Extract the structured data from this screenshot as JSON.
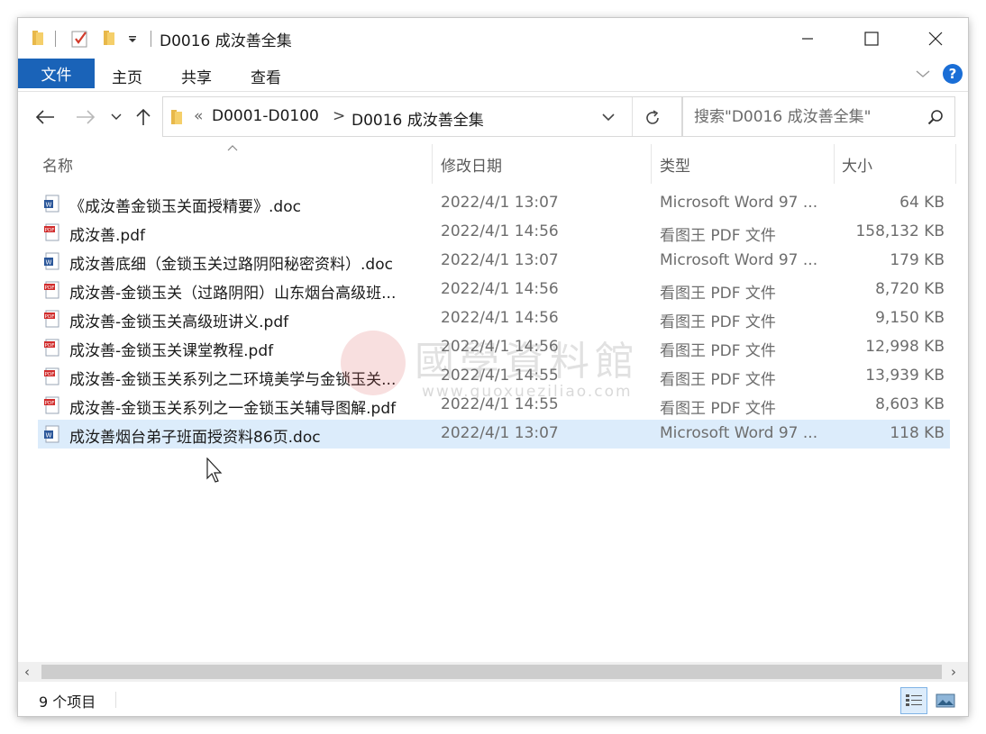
{
  "window": {
    "title": "D0016 成汝善全集",
    "minimize_icon": "minimize-icon",
    "maximize_icon": "maximize-icon",
    "close_icon": "close-icon"
  },
  "ribbon": {
    "tabs": [
      {
        "label": "文件",
        "active": true
      },
      {
        "label": "主页"
      },
      {
        "label": "共享"
      },
      {
        "label": "查看"
      }
    ]
  },
  "navigation": {
    "breadcrumb": [
      "«",
      "D0001-D0100",
      ">",
      "D0016 成汝善全集"
    ]
  },
  "search": {
    "placeholder": "搜索\"D0016 成汝善全集\""
  },
  "columns": {
    "name": "名称",
    "date": "修改日期",
    "type": "类型",
    "size": "大小"
  },
  "files": [
    {
      "name": "《成汝善金锁玉关面授精要》.doc",
      "date": "2022/4/1 13:07",
      "type": "Microsoft Word 97 ...",
      "size": "64 KB",
      "icon": "word-doc-icon"
    },
    {
      "name": "成汝善.pdf",
      "date": "2022/4/1 14:56",
      "type": "看图王 PDF 文件",
      "size": "158,132 KB",
      "icon": "pdf-file-icon"
    },
    {
      "name": "成汝善底细（金锁玉关过路阴阳秘密资料）.doc",
      "date": "2022/4/1 13:07",
      "type": "Microsoft Word 97 ...",
      "size": "179 KB",
      "icon": "word-doc-icon"
    },
    {
      "name": "成汝善-金锁玉关（过路阴阳）山东烟台高级班...",
      "date": "2022/4/1 14:56",
      "type": "看图王 PDF 文件",
      "size": "8,720 KB",
      "icon": "pdf-file-icon"
    },
    {
      "name": "成汝善-金锁玉关高级班讲义.pdf",
      "date": "2022/4/1 14:56",
      "type": "看图王 PDF 文件",
      "size": "9,150 KB",
      "icon": "pdf-file-icon"
    },
    {
      "name": "成汝善-金锁玉关课堂教程.pdf",
      "date": "2022/4/1 14:56",
      "type": "看图王 PDF 文件",
      "size": "12,998 KB",
      "icon": "pdf-file-icon"
    },
    {
      "name": "成汝善-金锁玉关系列之二环境美学与金锁玉关...",
      "date": "2022/4/1 14:55",
      "type": "看图王 PDF 文件",
      "size": "13,939 KB",
      "icon": "pdf-file-icon"
    },
    {
      "name": "成汝善-金锁玉关系列之一金锁玉关辅导图解.pdf",
      "date": "2022/4/1 14:55",
      "type": "看图王 PDF 文件",
      "size": "8,603 KB",
      "icon": "pdf-file-icon"
    },
    {
      "name": "成汝善烟台弟子班面授资料86页.doc",
      "date": "2022/4/1 13:07",
      "type": "Microsoft Word 97 ...",
      "size": "118 KB",
      "icon": "word-doc-icon",
      "selected": true
    }
  ],
  "watermark": {
    "title": "國學資料館",
    "url": "www.guoxueziliao.com"
  },
  "status": {
    "item_count": "9 个项目"
  },
  "colors": {
    "accent": "#1a63b8",
    "selection": "#dcecfb",
    "help": "#1a6ed6"
  }
}
